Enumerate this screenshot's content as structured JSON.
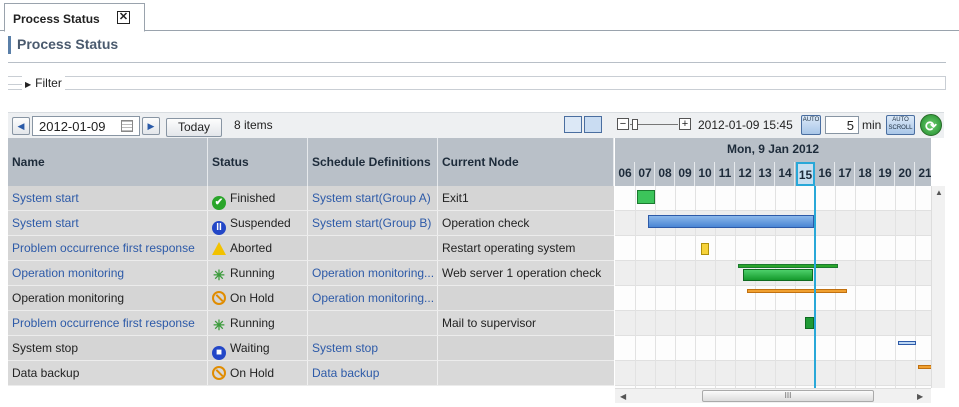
{
  "tab": {
    "label": "Process Status",
    "close": "✕"
  },
  "page_title": "Process Status",
  "filter": {
    "label": "Filter"
  },
  "toolbar": {
    "prev": "◀",
    "date": "2012-01-09",
    "next": "▶",
    "today": "Today",
    "items": "8 items",
    "zoom_minus": "−",
    "zoom_plus": "+",
    "datetime": "2012-01-09 15:45",
    "auto_refresh": "AUTO",
    "minutes": "5",
    "min_label": "min",
    "auto_scroll": "AUTO SCROLL",
    "refresh": "⟳"
  },
  "columns": {
    "name": "Name",
    "status": "Status",
    "schedule": "Schedule Definitions",
    "node": "Current Node"
  },
  "rows": [
    {
      "name": "System start",
      "name_link": true,
      "status": "Finished",
      "status_icon": "finished-icon",
      "schedule": "System start(Group A)",
      "node": "Exit1"
    },
    {
      "name": "System start",
      "name_link": true,
      "status": "Suspended",
      "status_icon": "suspended-icon",
      "schedule": "System start(Group B)",
      "node": "Operation check"
    },
    {
      "name": "Problem occurrence first response",
      "name_link": true,
      "status": "Aborted",
      "status_icon": "aborted-icon",
      "schedule": "",
      "node": "Restart operating system"
    },
    {
      "name": "Operation monitoring",
      "name_link": true,
      "status": "Running",
      "status_icon": "running-icon",
      "schedule": "Operation monitoring...",
      "node": "Web server 1 operation check"
    },
    {
      "name": "Operation monitoring",
      "name_link": false,
      "status": "On Hold",
      "status_icon": "on-hold-icon",
      "schedule": "Operation monitoring...",
      "node": ""
    },
    {
      "name": "Problem occurrence first response",
      "name_link": true,
      "status": "Running",
      "status_icon": "running-icon",
      "schedule": "",
      "node": "Mail to supervisor"
    },
    {
      "name": "System stop",
      "name_link": false,
      "status": "Waiting",
      "status_icon": "waiting-icon",
      "schedule": "System stop",
      "node": ""
    },
    {
      "name": "Data backup",
      "name_link": false,
      "status": "On Hold",
      "status_icon": "on-hold-icon",
      "schedule": "Data backup",
      "node": ""
    }
  ],
  "gantt": {
    "date_label": "Mon,  9 Jan 2012",
    "hours": [
      "06",
      "07",
      "08",
      "09",
      "10",
      "11",
      "12",
      "13",
      "14",
      "15",
      "16",
      "17",
      "18",
      "19",
      "20",
      "21"
    ],
    "current_hour": "15"
  },
  "scroll": {
    "thumb_grip": "III"
  },
  "colors": {
    "link": "#2d5aa8",
    "header_bg": "#b9c0c8",
    "now_line": "#29a8d8"
  }
}
